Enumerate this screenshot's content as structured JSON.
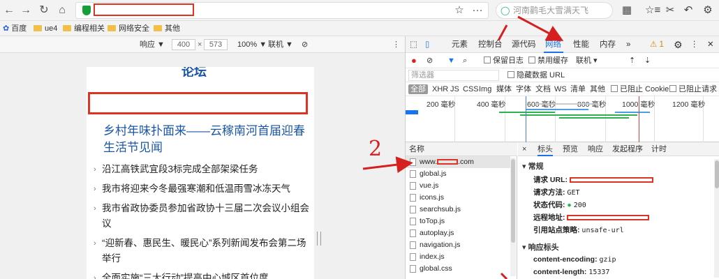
{
  "toolbar": {
    "back": "←",
    "forward": "→",
    "reload": "↻",
    "home": "⌂",
    "search_placeholder": "河南鹳毛大雪满天飞",
    "search_icon": "search-icon",
    "star": "☆",
    "more": "···",
    "grid": "▦",
    "bookmarks_star": "☆≡",
    "cut": "✂",
    "undo": "↶",
    "settings": "⚙"
  },
  "bookmarks": [
    {
      "label": "百度",
      "icon": "paw-icon"
    },
    {
      "label": "ue4",
      "icon": "folder-icon"
    },
    {
      "label": "编程相关",
      "icon": "folder-icon"
    },
    {
      "label": "网络安全",
      "icon": "folder-icon"
    },
    {
      "label": "其他",
      "icon": "folder-icon"
    }
  ],
  "device": {
    "mode": "响应 ▼",
    "width": "400",
    "times": "×",
    "height": "573",
    "zoom": "100% ▼",
    "network": "联机 ▼",
    "more": "⋮"
  },
  "page": {
    "section_head": "论坛",
    "headline": "乡村年味扑面来——云稼南河首届迎春生活节见闻",
    "news": [
      "沿江高铁武宜段3标完成全部架梁任务",
      "我市将迎来今冬最强寒潮和低温雨雪冰冻天气",
      "我市省政协委员参加省政协十三届二次会议小组会议",
      "“迎新春、惠民生、暖民心”系列新闻发布会第二场举行",
      "全面实施“三大行动”提高中心城区首位度"
    ]
  },
  "annotation": {
    "step2": "2"
  },
  "devtools": {
    "tabs": [
      "元素",
      "控制台",
      "源代码",
      "网络",
      "性能",
      "内存",
      "»"
    ],
    "warnings": "⚠ 1",
    "net_toolbar": {
      "preserve_log": "保留日志",
      "disable_cache": "禁用缓存",
      "throttle": "联机 ▾"
    },
    "filter_placeholder": "筛选器",
    "hide_data_url": "隐藏数据 URL",
    "types": [
      "全部",
      "XHR",
      "JS",
      "CSS",
      "Img",
      "媒体",
      "字体",
      "文档",
      "WS",
      "清单",
      "其他"
    ],
    "blocked_cookie": "已阻止 Cookie",
    "blocked_request": "已阻止请求",
    "timeline_ticks": [
      "200 毫秒",
      "400 毫秒",
      "600 毫秒",
      "800 毫秒",
      "1000 毫秒",
      "1200 毫秒"
    ],
    "name_header": "名称",
    "requests": [
      {
        "name_prefix": "www.",
        "name_suffix": ".com"
      },
      {
        "name": "global.js"
      },
      {
        "name": "vue.js"
      },
      {
        "name": "icons.js"
      },
      {
        "name": "searchsub.js"
      },
      {
        "name": "toTop.js"
      },
      {
        "name": "autoplay.js"
      },
      {
        "name": "navigation.js"
      },
      {
        "name": "index.js"
      },
      {
        "name": "global.css"
      }
    ],
    "detail_tabs": [
      "×",
      "标头",
      "预览",
      "响应",
      "发起程序",
      "计时"
    ],
    "general": {
      "title": "▾ 常规",
      "request_url": "请求 URL:",
      "method_label": "请求方法:",
      "method": "GET",
      "status_label": "状态代码:",
      "status": "200",
      "remote_label": "远程地址:",
      "referrer_label": "引用站点策略:",
      "referrer": "unsafe-url"
    },
    "response_headers": {
      "title": "▾ 响应标头",
      "encoding_label": "content-encoding:",
      "encoding": "gzip",
      "length_label": "content-length:",
      "length": "15337"
    }
  },
  "colors": {
    "accent": "#1a73e8",
    "annotation": "#d62020",
    "link": "#1a56a6"
  }
}
